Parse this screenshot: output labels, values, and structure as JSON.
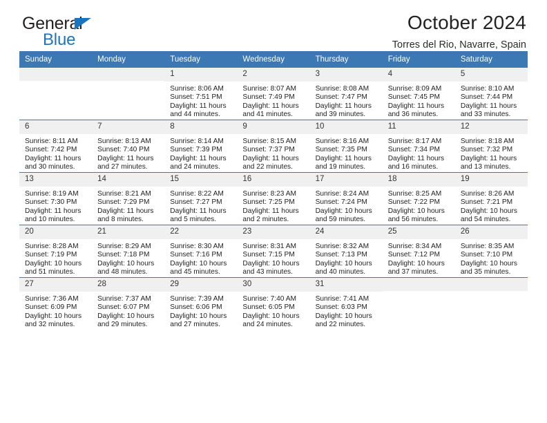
{
  "brand": {
    "name_top": "General",
    "name_bottom": "Blue",
    "triangle_color": "#1c75bc"
  },
  "header": {
    "title": "October 2024",
    "subtitle": "Torres del Rio, Navarre, Spain"
  },
  "colors": {
    "header_blue": "#3b78b4",
    "daynum_band": "#f0f0f0",
    "text": "#222222"
  },
  "weekday_headers": [
    "Sunday",
    "Monday",
    "Tuesday",
    "Wednesday",
    "Thursday",
    "Friday",
    "Saturday"
  ],
  "labels": {
    "sunrise_prefix": "Sunrise:",
    "sunset_prefix": "Sunset:",
    "daylight_prefix": "Daylight:"
  },
  "weeks": [
    [
      {
        "day": "",
        "empty": true
      },
      {
        "day": "",
        "empty": true
      },
      {
        "day": "1",
        "sunrise": "Sunrise: 8:06 AM",
        "sunset": "Sunset: 7:51 PM",
        "daylight": "Daylight: 11 hours and 44 minutes."
      },
      {
        "day": "2",
        "sunrise": "Sunrise: 8:07 AM",
        "sunset": "Sunset: 7:49 PM",
        "daylight": "Daylight: 11 hours and 41 minutes."
      },
      {
        "day": "3",
        "sunrise": "Sunrise: 8:08 AM",
        "sunset": "Sunset: 7:47 PM",
        "daylight": "Daylight: 11 hours and 39 minutes."
      },
      {
        "day": "4",
        "sunrise": "Sunrise: 8:09 AM",
        "sunset": "Sunset: 7:45 PM",
        "daylight": "Daylight: 11 hours and 36 minutes."
      },
      {
        "day": "5",
        "sunrise": "Sunrise: 8:10 AM",
        "sunset": "Sunset: 7:44 PM",
        "daylight": "Daylight: 11 hours and 33 minutes."
      }
    ],
    [
      {
        "day": "6",
        "sunrise": "Sunrise: 8:11 AM",
        "sunset": "Sunset: 7:42 PM",
        "daylight": "Daylight: 11 hours and 30 minutes."
      },
      {
        "day": "7",
        "sunrise": "Sunrise: 8:13 AM",
        "sunset": "Sunset: 7:40 PM",
        "daylight": "Daylight: 11 hours and 27 minutes."
      },
      {
        "day": "8",
        "sunrise": "Sunrise: 8:14 AM",
        "sunset": "Sunset: 7:39 PM",
        "daylight": "Daylight: 11 hours and 24 minutes."
      },
      {
        "day": "9",
        "sunrise": "Sunrise: 8:15 AM",
        "sunset": "Sunset: 7:37 PM",
        "daylight": "Daylight: 11 hours and 22 minutes."
      },
      {
        "day": "10",
        "sunrise": "Sunrise: 8:16 AM",
        "sunset": "Sunset: 7:35 PM",
        "daylight": "Daylight: 11 hours and 19 minutes."
      },
      {
        "day": "11",
        "sunrise": "Sunrise: 8:17 AM",
        "sunset": "Sunset: 7:34 PM",
        "daylight": "Daylight: 11 hours and 16 minutes."
      },
      {
        "day": "12",
        "sunrise": "Sunrise: 8:18 AM",
        "sunset": "Sunset: 7:32 PM",
        "daylight": "Daylight: 11 hours and 13 minutes."
      }
    ],
    [
      {
        "day": "13",
        "sunrise": "Sunrise: 8:19 AM",
        "sunset": "Sunset: 7:30 PM",
        "daylight": "Daylight: 11 hours and 10 minutes."
      },
      {
        "day": "14",
        "sunrise": "Sunrise: 8:21 AM",
        "sunset": "Sunset: 7:29 PM",
        "daylight": "Daylight: 11 hours and 8 minutes."
      },
      {
        "day": "15",
        "sunrise": "Sunrise: 8:22 AM",
        "sunset": "Sunset: 7:27 PM",
        "daylight": "Daylight: 11 hours and 5 minutes."
      },
      {
        "day": "16",
        "sunrise": "Sunrise: 8:23 AM",
        "sunset": "Sunset: 7:25 PM",
        "daylight": "Daylight: 11 hours and 2 minutes."
      },
      {
        "day": "17",
        "sunrise": "Sunrise: 8:24 AM",
        "sunset": "Sunset: 7:24 PM",
        "daylight": "Daylight: 10 hours and 59 minutes."
      },
      {
        "day": "18",
        "sunrise": "Sunrise: 8:25 AM",
        "sunset": "Sunset: 7:22 PM",
        "daylight": "Daylight: 10 hours and 56 minutes."
      },
      {
        "day": "19",
        "sunrise": "Sunrise: 8:26 AM",
        "sunset": "Sunset: 7:21 PM",
        "daylight": "Daylight: 10 hours and 54 minutes."
      }
    ],
    [
      {
        "day": "20",
        "sunrise": "Sunrise: 8:28 AM",
        "sunset": "Sunset: 7:19 PM",
        "daylight": "Daylight: 10 hours and 51 minutes."
      },
      {
        "day": "21",
        "sunrise": "Sunrise: 8:29 AM",
        "sunset": "Sunset: 7:18 PM",
        "daylight": "Daylight: 10 hours and 48 minutes."
      },
      {
        "day": "22",
        "sunrise": "Sunrise: 8:30 AM",
        "sunset": "Sunset: 7:16 PM",
        "daylight": "Daylight: 10 hours and 45 minutes."
      },
      {
        "day": "23",
        "sunrise": "Sunrise: 8:31 AM",
        "sunset": "Sunset: 7:15 PM",
        "daylight": "Daylight: 10 hours and 43 minutes."
      },
      {
        "day": "24",
        "sunrise": "Sunrise: 8:32 AM",
        "sunset": "Sunset: 7:13 PM",
        "daylight": "Daylight: 10 hours and 40 minutes."
      },
      {
        "day": "25",
        "sunrise": "Sunrise: 8:34 AM",
        "sunset": "Sunset: 7:12 PM",
        "daylight": "Daylight: 10 hours and 37 minutes."
      },
      {
        "day": "26",
        "sunrise": "Sunrise: 8:35 AM",
        "sunset": "Sunset: 7:10 PM",
        "daylight": "Daylight: 10 hours and 35 minutes."
      }
    ],
    [
      {
        "day": "27",
        "sunrise": "Sunrise: 7:36 AM",
        "sunset": "Sunset: 6:09 PM",
        "daylight": "Daylight: 10 hours and 32 minutes."
      },
      {
        "day": "28",
        "sunrise": "Sunrise: 7:37 AM",
        "sunset": "Sunset: 6:07 PM",
        "daylight": "Daylight: 10 hours and 29 minutes."
      },
      {
        "day": "29",
        "sunrise": "Sunrise: 7:39 AM",
        "sunset": "Sunset: 6:06 PM",
        "daylight": "Daylight: 10 hours and 27 minutes."
      },
      {
        "day": "30",
        "sunrise": "Sunrise: 7:40 AM",
        "sunset": "Sunset: 6:05 PM",
        "daylight": "Daylight: 10 hours and 24 minutes."
      },
      {
        "day": "31",
        "sunrise": "Sunrise: 7:41 AM",
        "sunset": "Sunset: 6:03 PM",
        "daylight": "Daylight: 10 hours and 22 minutes."
      },
      {
        "day": "",
        "empty": true
      },
      {
        "day": "",
        "empty": true
      }
    ]
  ]
}
